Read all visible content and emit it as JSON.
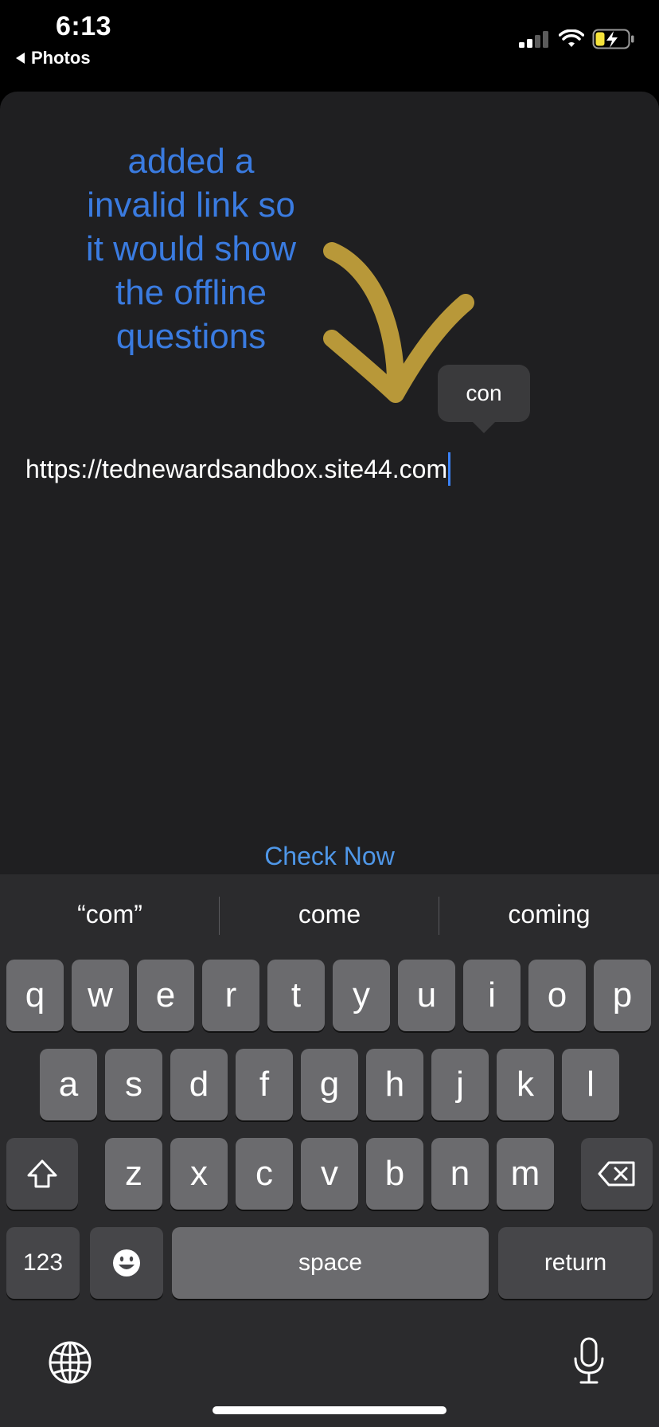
{
  "status_bar": {
    "time": "6:13",
    "back_label": "Photos",
    "battery_color": "#f5e33b"
  },
  "annotation": {
    "lines": [
      "added a",
      "invalid link so",
      "it would show",
      "the offline",
      "questions"
    ],
    "text_color": "#3a7be0",
    "arrow_color": "#c9a53c"
  },
  "autocorrect": {
    "bubble_text": "con"
  },
  "url_field": {
    "value": "https://tednewardsandbox.site44.com"
  },
  "check_now": {
    "label": "Check Now",
    "color": "#4f97e8"
  },
  "keyboard": {
    "suggestions": [
      "“com”",
      "come",
      "coming"
    ],
    "row1": [
      "q",
      "w",
      "e",
      "r",
      "t",
      "y",
      "u",
      "i",
      "o",
      "p"
    ],
    "row2": [
      "a",
      "s",
      "d",
      "f",
      "g",
      "h",
      "j",
      "k",
      "l"
    ],
    "row3": [
      "z",
      "x",
      "c",
      "v",
      "b",
      "n",
      "m"
    ],
    "numbers_label": "123",
    "space_label": "space",
    "return_label": "return",
    "shift_icon": "shift-icon",
    "delete_icon": "delete-icon",
    "emoji_icon": "emoji-icon",
    "globe_icon": "globe-icon",
    "mic_icon": "microphone-icon"
  }
}
